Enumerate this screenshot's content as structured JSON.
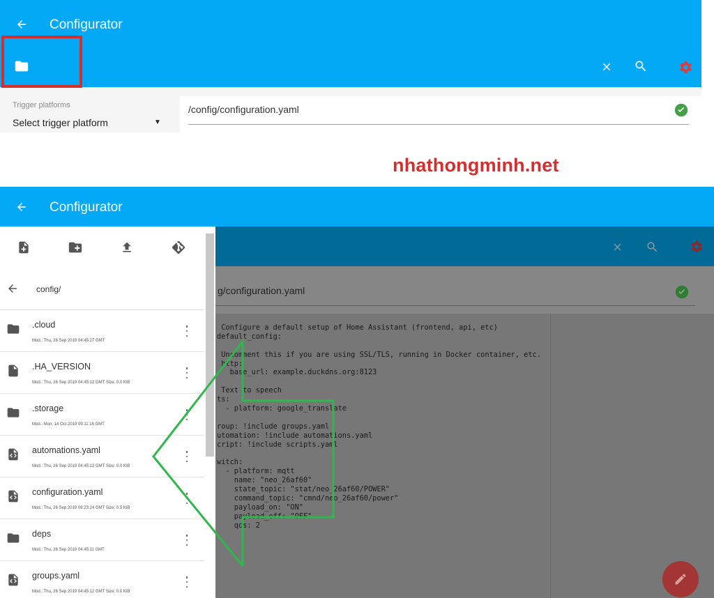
{
  "top": {
    "title": "Configurator",
    "trigger_label": "Trigger platforms",
    "trigger_value": "Select trigger platform",
    "path": "/config/configuration.yaml"
  },
  "watermark": "nhathongminh.net",
  "bottom": {
    "title": "Configurator",
    "path": "g/configuration.yaml",
    "drawer": {
      "folder": "config/",
      "files": [
        {
          "name": ".cloud",
          "meta": "Mod.: Thu, 26 Sep 2019 04:45:27 GMT",
          "icon": "folder-icon"
        },
        {
          "name": ".HA_VERSION",
          "meta": "Mod.: Thu, 26 Sep 2019 04:45:12 GMT  Size: 0.0 KiB",
          "icon": "file-icon"
        },
        {
          "name": ".storage",
          "meta": "Mod.: Mon, 14 Oct 2019 09:11:16 GMT",
          "icon": "folder-icon"
        },
        {
          "name": "automations.yaml",
          "meta": "Mod.: Thu, 26 Sep 2019 04:45:12 GMT  Size: 0.0 KiB",
          "icon": "code-file-icon"
        },
        {
          "name": "configuration.yaml",
          "meta": "Mod.: Thu, 26 Sep 2019 08:23:24 GMT  Size: 0.5 KiB",
          "icon": "code-file-icon"
        },
        {
          "name": "deps",
          "meta": "Mod.: Thu, 26 Sep 2019 04:45:11 GMT",
          "icon": "folder-icon"
        },
        {
          "name": "groups.yaml",
          "meta": "Mod.: Thu, 26 Sep 2019 04:45:12 GMT  Size: 0.0 KiB",
          "icon": "code-file-icon"
        }
      ]
    },
    "code_lines": [
      " Configure a default setup of Home Assistant (frontend, api, etc)",
      "default_config:",
      "",
      " Uncomment this if you are using SSL/TLS, running in Docker container, etc.",
      " http:",
      "   base_url: example.duckdns.org:8123",
      "",
      " Text to speech",
      "ts:",
      "  - platform: google_translate",
      "",
      "roup: !include groups.yaml",
      "utomation: !include automations.yaml",
      "cript: !include scripts.yaml",
      "",
      "witch:",
      "  - platform: mqtt",
      "    name: \"neo_26af60\"",
      "    state_topic: \"stat/neo_26af60/POWER\"",
      "    command_topic: \"cmnd/neo_26af60/power\"",
      "    payload_on: \"ON\"",
      "    payload_off: \"OFF\"",
      "    qos: 2"
    ]
  },
  "colors": {
    "app_bar": "#03a9f4",
    "highlight": "#d32f2f",
    "check": "#43a047",
    "annotation_arrow": "#2eb84b"
  }
}
